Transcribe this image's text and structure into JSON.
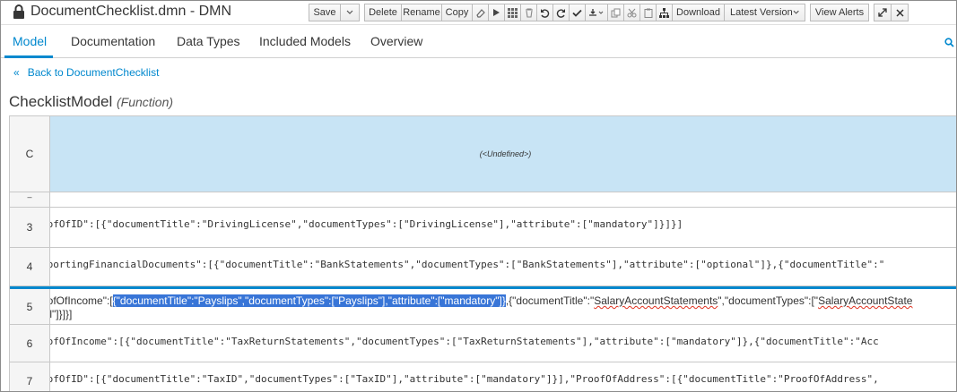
{
  "window": {
    "title": "DocumentChecklist.dmn - DMN"
  },
  "toolbar": {
    "save": "Save",
    "delete": "Delete",
    "rename": "Rename",
    "copy": "Copy",
    "download": "Download",
    "latest_version": "Latest Version",
    "view_alerts": "View Alerts"
  },
  "tabs": [
    {
      "label": "Model",
      "active": true
    },
    {
      "label": "Documentation"
    },
    {
      "label": "Data Types"
    },
    {
      "label": "Included Models"
    },
    {
      "label": "Overview"
    }
  ],
  "back_link": "Back to DocumentChecklist",
  "function": {
    "name": "ChecklistModel",
    "kind": "(Function)"
  },
  "grid": {
    "header_col": "C",
    "header_value": "(<Undefined>)",
    "rows": [
      {
        "num": "3",
        "text": "oofOfID\":[{\"documentTitle\":\"DrivingLicense\",\"documentTypes\":[\"DrivingLicense\"],\"attribute\":[\"mandatory\"]}]}]"
      },
      {
        "num": "4",
        "text": "pportingFinancialDocuments\":[{\"documentTitle\":\"BankStatements\",\"documentTypes\":[\"BankStatements\"],\"attribute\":[\"optional\"]},{\"documentTitle\":\""
      },
      {
        "num": "5",
        "prefix": "roofOfIncome\":[",
        "selected": "{\"documentTitle\":\"Payslips\",\"documentTypes\":[\"Payslips\"],\"attribute\":[\"mandatory\"]}",
        "suffix_a": ",{\"documentTitle\":\"",
        "suffix_b": "SalaryAccountStatements",
        "suffix_c": "\",\"documentTypes\":[\"",
        "suffix_d": "SalaryAccountState",
        "line2": "nal\"]}]}]"
      },
      {
        "num": "6",
        "text": "oofOfIncome\":[{\"documentTitle\":\"TaxReturnStatements\",\"documentTypes\":[\"TaxReturnStatements\"],\"attribute\":[\"mandatory\"]},{\"documentTitle\":\"Acc"
      },
      {
        "num": "7",
        "text": "oofOfID\":[{\"documentTitle\":\"TaxID\",\"documentTypes\":[\"TaxID\"],\"attribute\":[\"mandatory\"]}],\"ProofOfAddress\":[{\"documentTitle\":\"ProofOfAddress\","
      }
    ]
  },
  "colors": {
    "accent": "#0088ce",
    "header_blue": "#c8e4f5",
    "selection": "#3875d7"
  }
}
